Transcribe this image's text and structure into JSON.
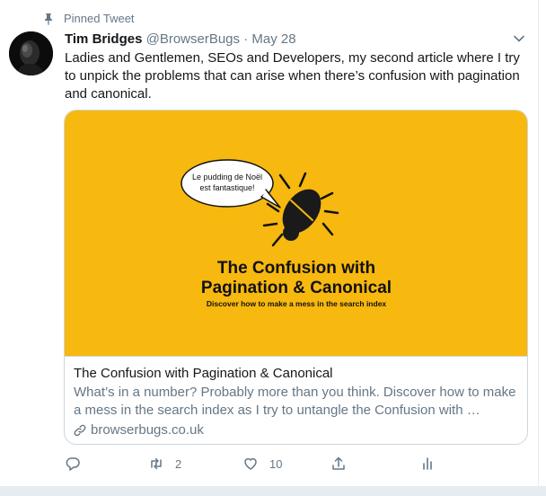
{
  "pinned_label": "Pinned Tweet",
  "author": {
    "name": "Tim Bridges",
    "handle": "@BrowserBugs",
    "date": "May 28"
  },
  "tweet_text": "Ladies and Gentlemen, SEOs and Developers, my second article where I try to unpick the problems that can arise when there’s confusion with pagination and canonical.",
  "card": {
    "image": {
      "bubble_line1": "Le pudding de Noël",
      "bubble_line2": "est fantastique!",
      "headline_line1": "The Confusion with",
      "headline_line2": "Pagination & Canonical",
      "tagline": "Discover how to make a mess in the search index",
      "background_color": "#f7b80f"
    },
    "title": "The Confusion with Pagination & Canonical",
    "description": "What’s in a number? Probably more than you think. Discover how to make a mess in the search index as I try to untangle the Confusion with …",
    "domain": "browserbugs.co.uk"
  },
  "actions": {
    "reply_count": "",
    "retweet_count": "2",
    "like_count": "10"
  },
  "icons": [
    "pin-icon",
    "chevron-down-icon",
    "link-icon",
    "reply-icon",
    "retweet-icon",
    "like-icon",
    "share-icon",
    "analytics-icon",
    "bug-icon"
  ],
  "colors": {
    "text": "#14171a",
    "secondary_text": "#657786",
    "border": "#ccd6dd",
    "card_image_bg": "#f7b80f"
  }
}
